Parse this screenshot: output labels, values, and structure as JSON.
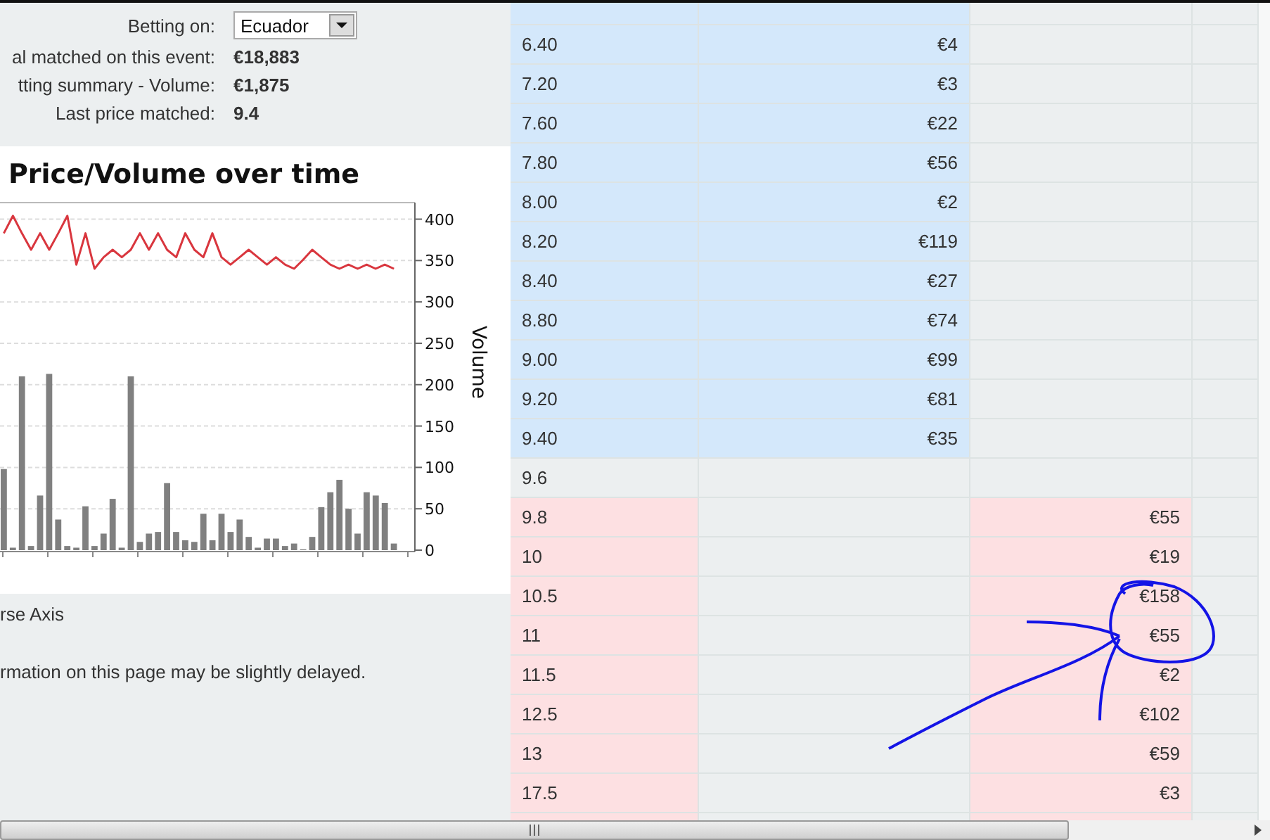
{
  "betting_form": {
    "fields": [
      {
        "kind": "select",
        "label": "Betting on:",
        "value": "Ecuador"
      },
      {
        "kind": "text",
        "label": "al matched on this event:",
        "value": "€18,883"
      },
      {
        "kind": "text",
        "label": "tting summary - Volume:",
        "value": "€1,875"
      },
      {
        "kind": "text",
        "label": "Last price matched:",
        "value": "9.4"
      }
    ]
  },
  "chart": {
    "chart_data": {
      "type": "bar",
      "title": "Price/Volume over time",
      "ylabel": "Volume",
      "ylim": [
        0,
        420
      ],
      "grid": true,
      "yticks": [
        0,
        50,
        100,
        150,
        200,
        250,
        300,
        350,
        400
      ],
      "series": [
        {
          "color": "#808080",
          "values": [
            98,
            3,
            210,
            5,
            66,
            213,
            37,
            5,
            3,
            53,
            5,
            20,
            62,
            3,
            210,
            10,
            20,
            22,
            81,
            22,
            12,
            10,
            44,
            12,
            44,
            22,
            37,
            16,
            3,
            14,
            14,
            5,
            8,
            1,
            16,
            52,
            70,
            85,
            50,
            20,
            70,
            66,
            57,
            8
          ]
        },
        {
          "type": "line",
          "color": "#d9363e",
          "values": [
            383,
            404,
            383,
            363,
            383,
            363,
            383,
            404,
            345,
            383,
            340,
            354,
            363,
            354,
            363,
            383,
            363,
            383,
            363,
            354,
            383,
            363,
            354,
            383,
            354,
            345,
            354,
            363,
            354,
            345,
            354,
            345,
            340,
            351,
            363,
            354,
            345,
            340,
            345,
            340,
            345,
            340,
            345,
            340
          ]
        }
      ]
    }
  },
  "notes": [
    "rse Axis",
    "rmation on this page may be slightly delayed."
  ],
  "price_table": {
    "rows": [
      {
        "kind": "back"
      },
      {
        "kind": "back",
        "price": "6.40",
        "amount": "€4"
      },
      {
        "kind": "back",
        "price": "7.20",
        "amount": "€3"
      },
      {
        "kind": "back",
        "price": "7.60",
        "amount": "€22"
      },
      {
        "kind": "back",
        "price": "7.80",
        "amount": "€56"
      },
      {
        "kind": "back",
        "price": "8.00",
        "amount": "€2"
      },
      {
        "kind": "back",
        "price": "8.20",
        "amount": "€119"
      },
      {
        "kind": "back",
        "price": "8.40",
        "amount": "€27"
      },
      {
        "kind": "back",
        "price": "8.80",
        "amount": "€74"
      },
      {
        "kind": "back",
        "price": "9.00",
        "amount": "€99"
      },
      {
        "kind": "back",
        "price": "9.20",
        "amount": "€81"
      },
      {
        "kind": "back",
        "price": "9.40",
        "amount": "€35"
      },
      {
        "kind": "none",
        "price": "9.6"
      },
      {
        "kind": "lay",
        "price": "9.8",
        "amount": "€55"
      },
      {
        "kind": "lay",
        "price": "10",
        "amount": "€19"
      },
      {
        "kind": "lay",
        "price": "10.5",
        "amount": "€158"
      },
      {
        "kind": "lay",
        "price": "11",
        "amount": "€55"
      },
      {
        "kind": "lay",
        "price": "11.5",
        "amount": "€2"
      },
      {
        "kind": "lay",
        "price": "12.5",
        "amount": "€102"
      },
      {
        "kind": "lay",
        "price": "13",
        "amount": "€59"
      },
      {
        "kind": "lay",
        "price": "17.5",
        "amount": "€3"
      },
      {
        "kind": "lay"
      }
    ]
  }
}
